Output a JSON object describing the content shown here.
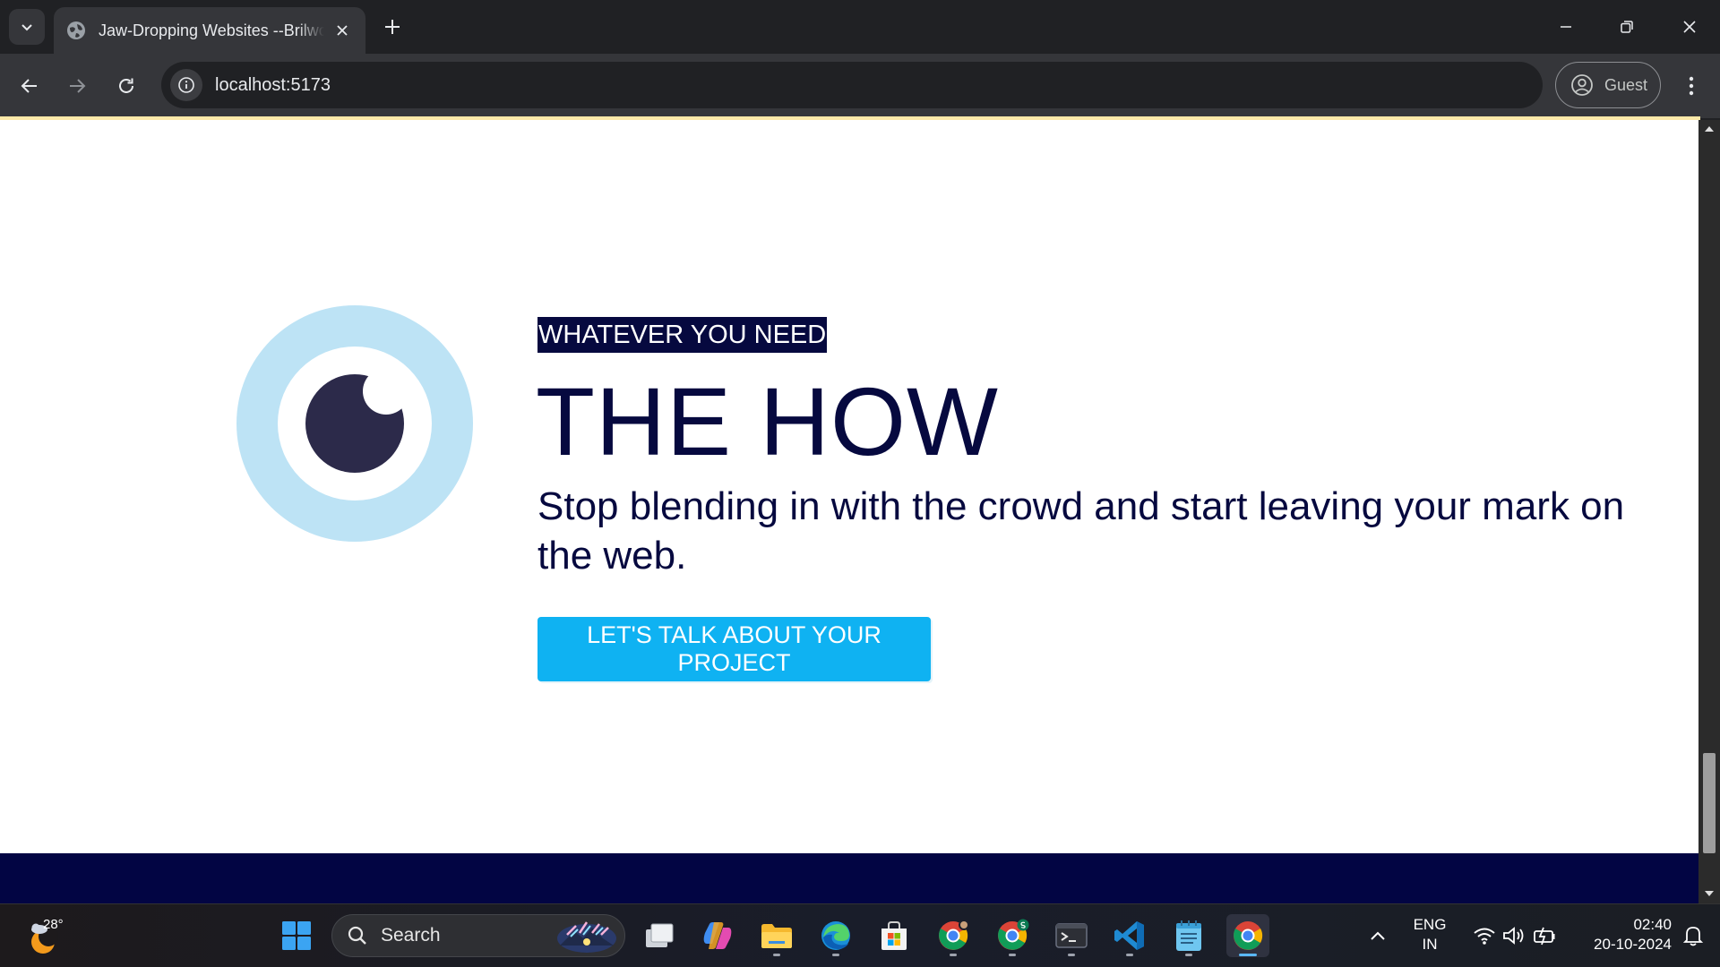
{
  "browser": {
    "tab_title": "Jaw-Dropping Websites --Brilworks",
    "url": "localhost:5173",
    "profile_label": "Guest"
  },
  "page": {
    "eyebrow": "WHATEVER YOU NEED",
    "headline": "THE HOW",
    "subtext": "Stop blending in with the crowd and start leaving your mark on the web.",
    "cta_label": "LET'S TALK ABOUT YOUR PROJECT"
  },
  "colors": {
    "navy": "#06093f",
    "cta_blue": "#0fb2f2",
    "eye_ring": "#bde3f5",
    "pupil": "#2c2a4a"
  },
  "taskbar": {
    "weather_temp": "28°",
    "search_label": "Search",
    "language": "ENG",
    "region": "IN",
    "time": "02:40",
    "date": "20-10-2024",
    "pinned_apps": [
      "windows-start-icon",
      "task-view-icon",
      "copilot-icon",
      "file-explorer-icon",
      "edge-icon",
      "microsoft-store-icon",
      "chrome-profile-1-icon",
      "chrome-profile-2-icon",
      "terminal-icon",
      "vscode-icon",
      "notepad-icon",
      "chrome-icon"
    ]
  }
}
